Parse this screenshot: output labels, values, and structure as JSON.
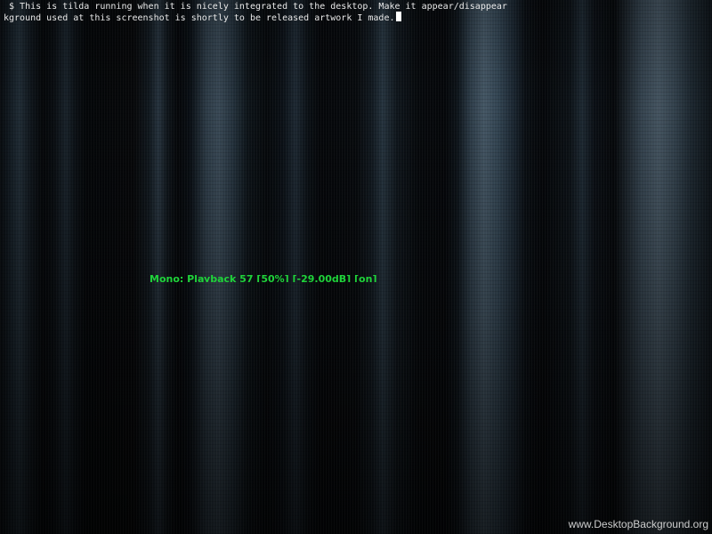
{
  "terminal": {
    "app": "tilda",
    "lines": [
      " $ This is tilda running when it is nicely integrated to the desktop. Make it appear/disappear",
      "kground used at this screenshot is shortly to be released artwork I made."
    ],
    "text_color": "#e8e8e8",
    "cursor_color": "#ffffff"
  },
  "mixer_status": {
    "text": "Mono: Playback 57 [50%] [-29.00dB] [on]",
    "color": "#1fd33a"
  },
  "watermark": {
    "text": "www.DesktopBackground.org"
  }
}
